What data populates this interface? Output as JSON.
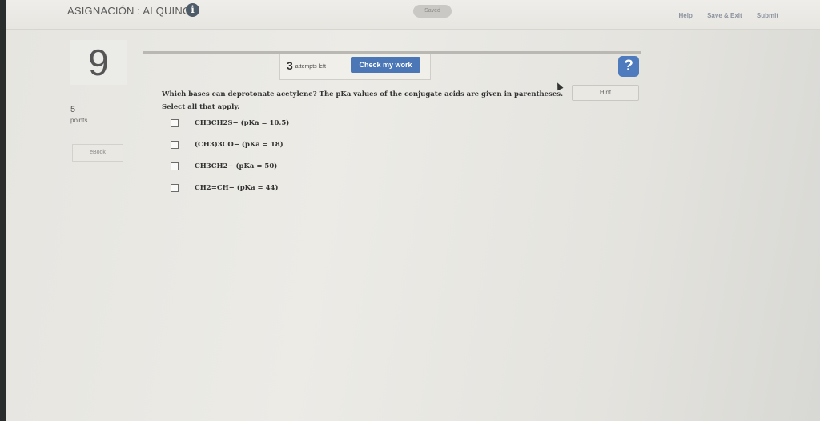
{
  "header": {
    "title": "ASIGNACIÓN : ALQUINOS",
    "info_icon": "info-icon",
    "saved_label": "Saved",
    "links": [
      "Help",
      "Save & Exit",
      "Submit"
    ]
  },
  "question_meta": {
    "number": "9",
    "points_value": "5",
    "points_label": "points",
    "ebook_label": "eBook"
  },
  "toolbar": {
    "attempts_count": "3",
    "attempts_label": "attempts left",
    "check_label": "Check my work",
    "help_icon": "question-mark-icon",
    "hint_label": "Hint"
  },
  "question": {
    "line1": "Which bases can deprotonate acetylene? The pKa values of the conjugate acids are given in parentheses.",
    "line2": "Select all that apply.",
    "options": [
      "CH3CH2S− (pKa = 10.5)",
      "(CH3)3CO− (pKa = 18)",
      "CH3CH2− (pKa = 50)",
      "CH2=CH− (pKa = 44)"
    ]
  },
  "colors": {
    "accent": "#4c77b6",
    "background": "#e6e5e0"
  }
}
